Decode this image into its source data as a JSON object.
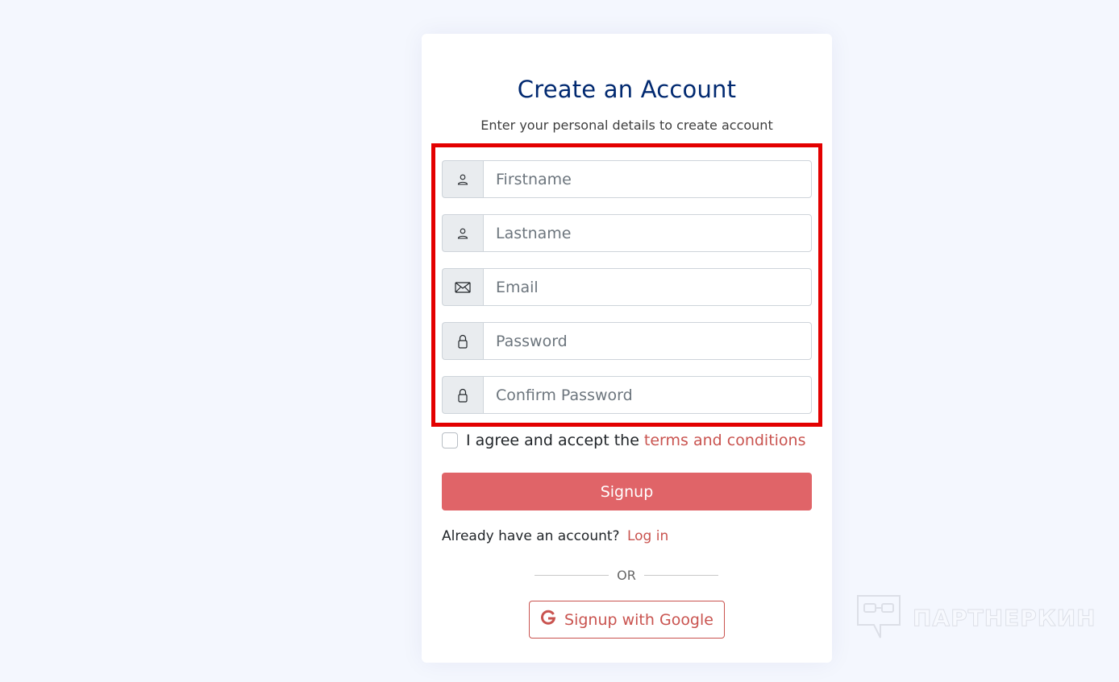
{
  "card": {
    "title": "Create an Account",
    "subtitle": "Enter your personal details to create account"
  },
  "fields": [
    {
      "placeholder": "Firstname",
      "icon": "person-icon"
    },
    {
      "placeholder": "Lastname",
      "icon": "person-icon"
    },
    {
      "placeholder": "Email",
      "icon": "envelope-icon"
    },
    {
      "placeholder": "Password",
      "icon": "lock-icon"
    },
    {
      "placeholder": "Confirm Password",
      "icon": "lock-icon"
    }
  ],
  "agree": {
    "text": "I agree and accept the",
    "link": "terms and conditions"
  },
  "signup_label": "Signup",
  "login": {
    "text": "Already have an account?",
    "link": "Log in"
  },
  "divider_label": "OR",
  "google_label": "Signup with Google",
  "watermark": "ПАРТНЕРКИН",
  "colors": {
    "title": "#012970",
    "accent": "#c9534f",
    "button": "#e06468",
    "highlight": "#e30000",
    "background": "#f4f7fe"
  }
}
